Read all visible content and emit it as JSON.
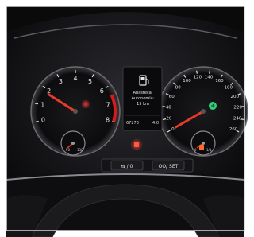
{
  "tachometer": {
    "ticks": [
      "0",
      "1",
      "2",
      "3",
      "4",
      "5",
      "6",
      "7",
      "8"
    ],
    "needle_value": 1.8,
    "needle_color": "#e8392a",
    "redline_color": "#d51b1b",
    "coolant_gauge": {
      "min": "50",
      "max": "130"
    }
  },
  "speedometer": {
    "ticks": [
      "0",
      "20",
      "40",
      "60",
      "80",
      "100",
      "120",
      "140",
      "160",
      "180",
      "200",
      "220",
      "240",
      "260"
    ],
    "needle_value": 0,
    "needle_color": "#e8392a",
    "fuel_gauge": {
      "empty": "0",
      "full": "1/1"
    }
  },
  "center_display": {
    "message_line1": "Abasteça.",
    "message_line2": "Autonomia:",
    "message_line3": "15 km",
    "odometer": "67273",
    "trip": "4.0",
    "fuel_icon": "fuel-pump-icon"
  },
  "buttons": {
    "left_label": "⇆ / 0",
    "right_label": "OO/ SET"
  },
  "warning_lights": {
    "low_fuel_color": "#ff6a2a",
    "turn_signal_color": "#2fd07a",
    "center_indicator_color": "#ff5a3a"
  }
}
